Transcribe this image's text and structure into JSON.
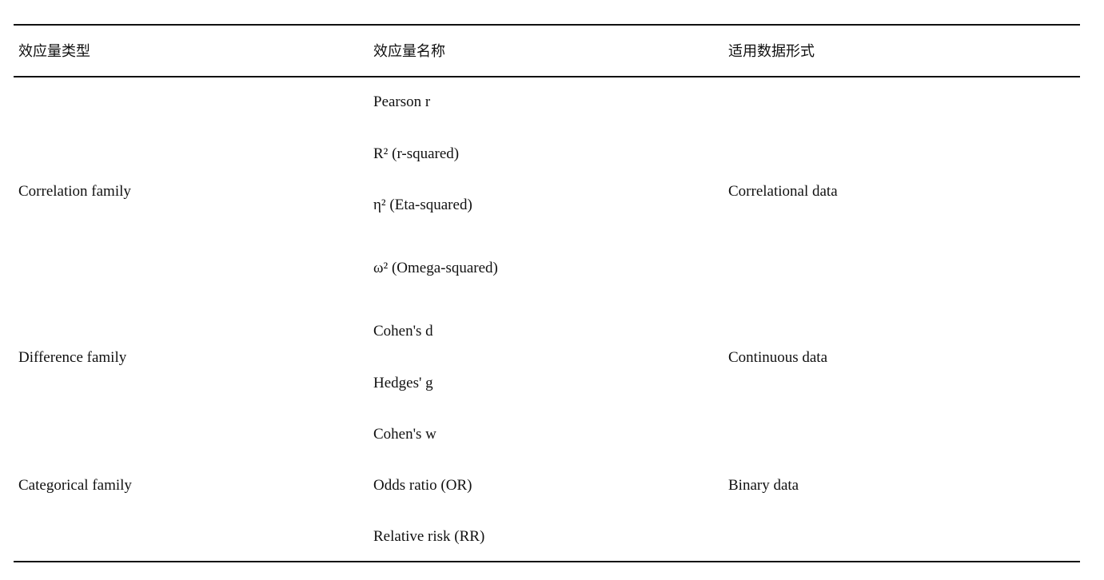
{
  "table": {
    "headers": [
      "效应量类型",
      "效应量名称",
      "适用数据形式"
    ],
    "groups": [
      {
        "type": "Correlation family",
        "names": [
          "Pearson r",
          "R² (r-squared)",
          "η² (Eta-squared)",
          "ω² (Omega-squared)"
        ],
        "data_form": "Correlational data"
      },
      {
        "type": "Difference family",
        "names": [
          "Cohen's d",
          "Hedges' g"
        ],
        "data_form": "Continuous data"
      },
      {
        "type": "Categorical family",
        "names": [
          "Cohen's w",
          "Odds ratio (OR)",
          "Relative risk (RR)"
        ],
        "data_form": "Binary data"
      }
    ]
  }
}
